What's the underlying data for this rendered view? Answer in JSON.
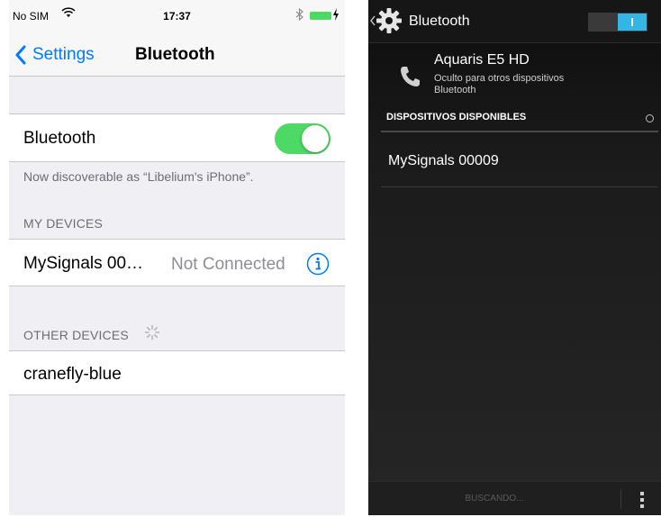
{
  "ios": {
    "status_bar": {
      "carrier": "No SIM",
      "time": "17:37"
    },
    "nav": {
      "back_label": "Settings",
      "title": "Bluetooth"
    },
    "bluetooth_cell": {
      "label": "Bluetooth",
      "switch_on": true
    },
    "discoverable_text": "Now discoverable as “Libelium's iPhone”.",
    "my_devices": {
      "header": "MY DEVICES",
      "items": [
        {
          "name": "MySignals 00…",
          "status": "Not Connected"
        }
      ]
    },
    "other_devices": {
      "header": "OTHER DEVICES",
      "items": [
        {
          "name": "cranefly-blue"
        }
      ]
    },
    "colors": {
      "accent": "#007aff",
      "switch_on": "#4cd964",
      "background": "#efeff4"
    }
  },
  "android": {
    "action_bar": {
      "title": "Bluetooth",
      "toggle_on": true
    },
    "this_device": {
      "name": "Aquaris E5 HD",
      "subtitle_line1": "Oculto para otros dispositivos",
      "subtitle_line2": "Bluetooth"
    },
    "section_header": "DISPOSITIVOS DISPONIBLES",
    "devices": [
      {
        "name": "MySignals 00009"
      }
    ],
    "bottom_bar": {
      "action": "BUSCANDO..."
    },
    "colors": {
      "accent": "#33b5e5",
      "background": "#1b1b1b"
    }
  }
}
